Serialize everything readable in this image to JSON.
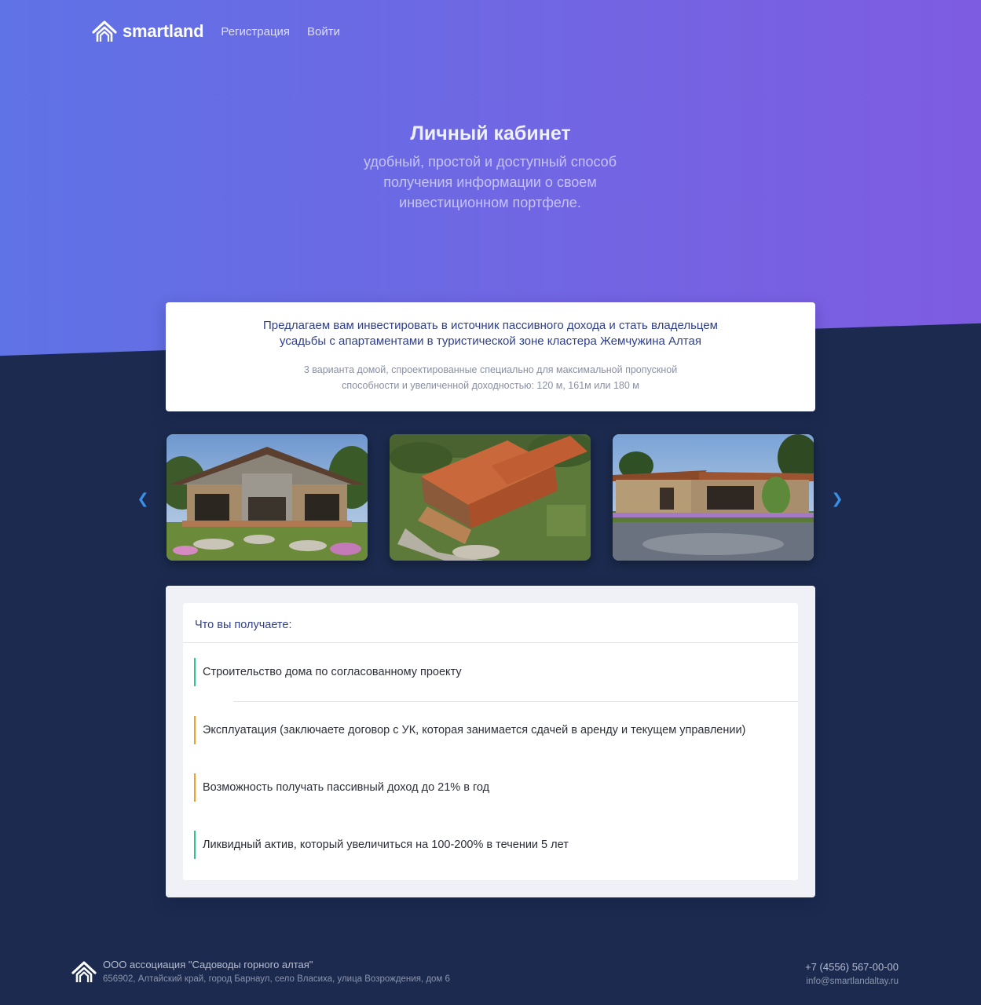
{
  "header": {
    "logo_text": "smartland",
    "logo_icon": "house-roof-icon",
    "nav": [
      {
        "label": "Регистрация"
      },
      {
        "label": "Войти"
      }
    ]
  },
  "hero": {
    "title": "Личный кабинет",
    "subtitle_lines": [
      "удобный, простой и доступный способ",
      "получения информации о своем",
      "инвестиционном портфеле."
    ]
  },
  "offer": {
    "title_lines": [
      "Предлагаем вам инвестировать в источник пассивного дохода и стать владельцем",
      "усадьбы с апартаментами в туристической зоне кластера Жемчужина Алтая"
    ],
    "text_lines": [
      "3 варианта домой, спроектированные специально для максимальной пропускной",
      "способности и увеличенной доходностью: 120 м, 161м или 180 м"
    ]
  },
  "carousel": {
    "prev_icon": "chevron-left-icon",
    "next_icon": "chevron-right-icon",
    "slides": [
      {
        "image": "house-front-render"
      },
      {
        "image": "house-aerial-render"
      },
      {
        "image": "house-side-render"
      }
    ]
  },
  "benefits": {
    "heading": "Что вы получаете:",
    "items": [
      {
        "text": "Строительство дома по согласованному проекту",
        "accent": "#2ec28d"
      },
      {
        "text": "Эксплуатация (заключаете договор с УК, которая занимается сдачей в аренду и текущем управлении)",
        "accent": "#f0a02a"
      },
      {
        "text": "Возможность получать пассивный доход до 21% в год",
        "accent": "#f0a02a"
      },
      {
        "text": "Ликвидный актив, который увеличиться на 100-200% в течении 5 лет",
        "accent": "#2ec28d"
      }
    ]
  },
  "footer": {
    "company": "ООО ассоциация \"Садоводы горного алтая\"",
    "address": "656902, Алтайский край, город Барнаул, село Власиха, улица Возрождения, дом 6",
    "phone": "+7 (4556) 567-00-00",
    "email": "info@smartlandaltay.ru"
  },
  "colors": {
    "hero_gradient_start": "#5f72e6",
    "hero_gradient_end": "#7e5ce2",
    "page_background": "#1b2a4e",
    "accent_blue": "#2f3f8c",
    "accent_green": "#2ec28d",
    "accent_orange": "#f0a02a"
  }
}
